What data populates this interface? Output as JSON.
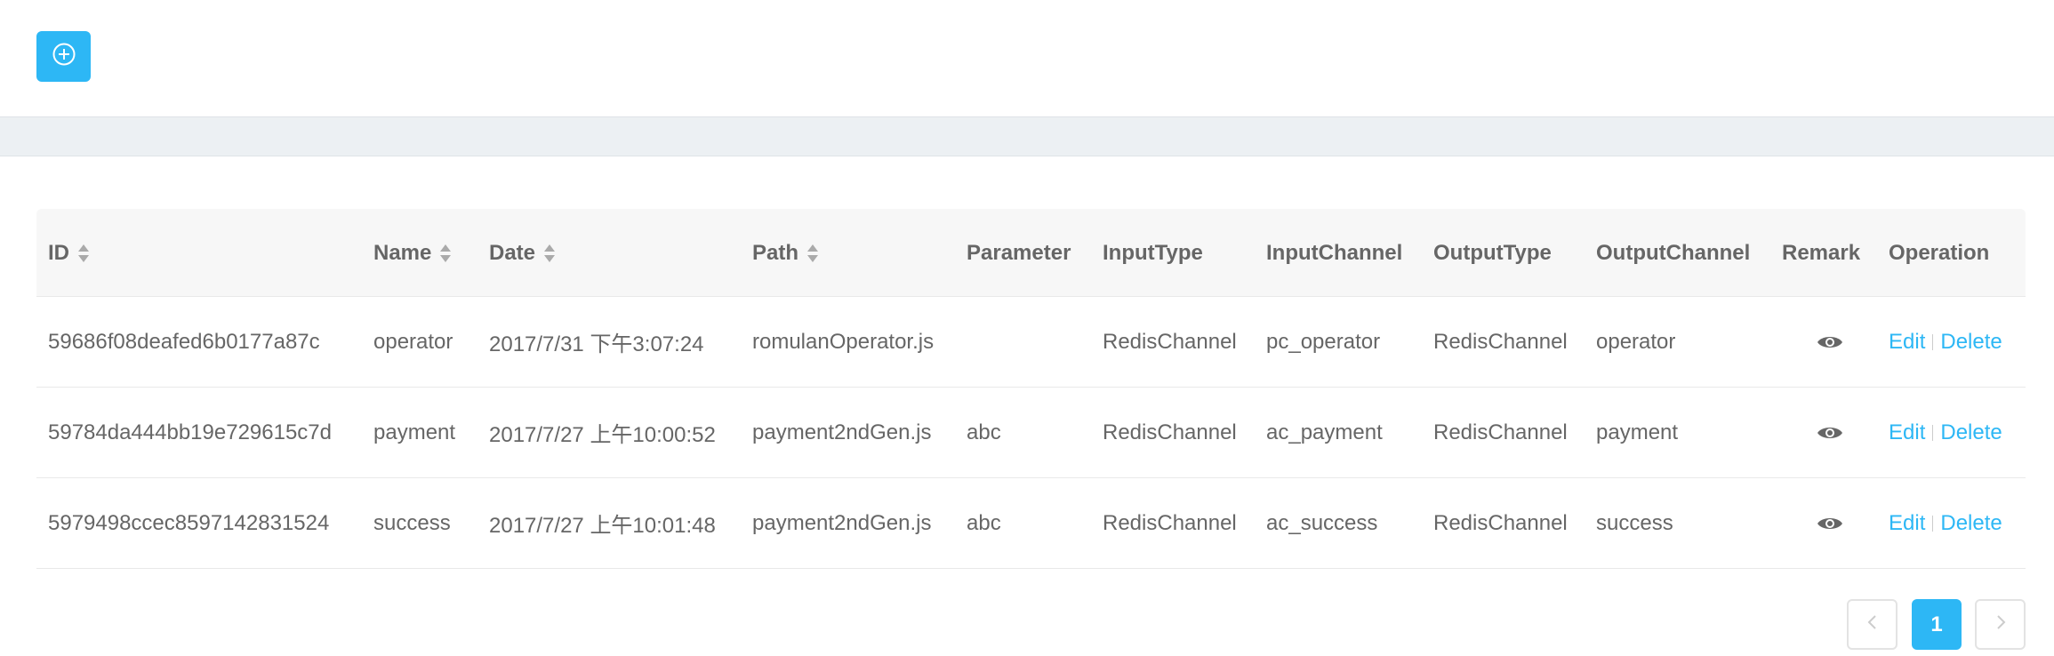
{
  "toolbar": {
    "add_icon": "plus-circle-icon"
  },
  "table": {
    "columns": {
      "id": "ID",
      "name": "Name",
      "date": "Date",
      "path": "Path",
      "parameter": "Parameter",
      "input_type": "InputType",
      "input_channel": "InputChannel",
      "output_type": "OutputType",
      "output_channel": "OutputChannel",
      "remark": "Remark",
      "operation": "Operation"
    },
    "rows": [
      {
        "id": "59686f08deafed6b0177a87c",
        "name": "operator",
        "date": "2017/7/31 下午3:07:24",
        "path": "romulanOperator.js",
        "parameter": "",
        "input_type": "RedisChannel",
        "input_channel": "pc_operator",
        "output_type": "RedisChannel",
        "output_channel": "operator",
        "edit": "Edit",
        "delete": "Delete"
      },
      {
        "id": "59784da444bb19e729615c7d",
        "name": "payment",
        "date": "2017/7/27 上午10:00:52",
        "path": "payment2ndGen.js",
        "parameter": "abc",
        "input_type": "RedisChannel",
        "input_channel": "ac_payment",
        "output_type": "RedisChannel",
        "output_channel": "payment",
        "edit": "Edit",
        "delete": "Delete"
      },
      {
        "id": "5979498ccec8597142831524",
        "name": "success",
        "date": "2017/7/27 上午10:01:48",
        "path": "payment2ndGen.js",
        "parameter": "abc",
        "input_type": "RedisChannel",
        "input_channel": "ac_success",
        "output_type": "RedisChannel",
        "output_channel": "success",
        "edit": "Edit",
        "delete": "Delete"
      }
    ]
  },
  "pagination": {
    "current": "1"
  },
  "colors": {
    "accent": "#2db7f5",
    "text": "#666666",
    "background": "#ecf0f3"
  }
}
